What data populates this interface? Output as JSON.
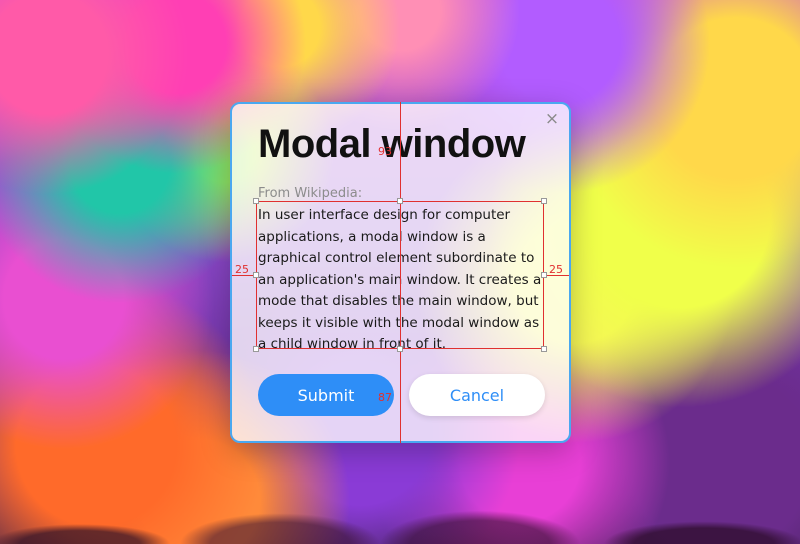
{
  "modal": {
    "close_glyph": "×",
    "title": "Modal window",
    "source": "From Wikipedia:",
    "body": "In user interface design for computer applications, a modal window is a graphical control element subordinate to an application's main window. It creates a mode that disables the main window, but keeps it visible with the modal window as a child window in front of it.",
    "submit_label": "Submit",
    "cancel_label": "Cancel"
  },
  "overlay": {
    "measure_top": "93",
    "measure_left": "25",
    "measure_right": "25",
    "measure_bottom": "87"
  },
  "colors": {
    "accent": "#2e8ef7",
    "modal_border": "#4aa8f0",
    "guide": "#e03030"
  }
}
